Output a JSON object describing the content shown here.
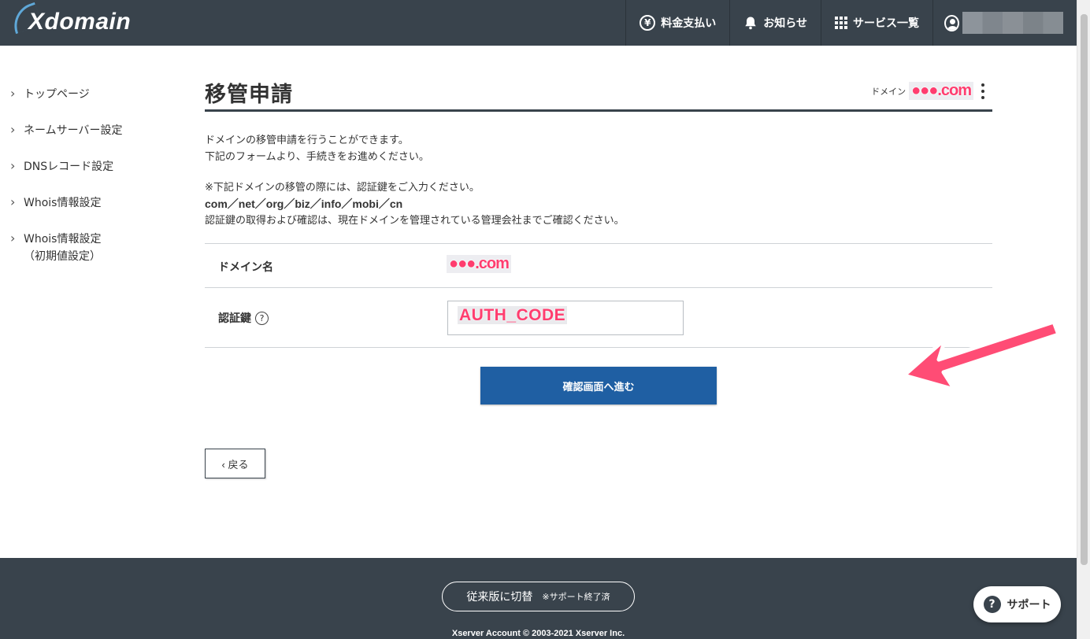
{
  "header": {
    "logo_text": "Xdomain",
    "nav": [
      {
        "label": "料金支払い",
        "icon": "yen-icon"
      },
      {
        "label": "お知らせ",
        "icon": "bell-icon"
      },
      {
        "label": "サービス一覧",
        "icon": "grid-icon"
      }
    ],
    "user_icon": "user-icon"
  },
  "sidebar": {
    "items": [
      {
        "label": "トップページ"
      },
      {
        "label": "ネームサーバー設定"
      },
      {
        "label": "DNSレコード設定"
      },
      {
        "label": "Whois情報設定"
      },
      {
        "label": "Whois情報設定",
        "sub": "（初期値設定）"
      }
    ]
  },
  "page": {
    "title": "移管申請",
    "domain_label": "ドメイン",
    "domain_value": "●●●.com",
    "intro_line1": "ドメインの移管申請を行うことができます。",
    "intro_line2": "下記のフォームより、手続きをお進めください。",
    "note_line1": "※下記ドメインの移管の際には、認証鍵をご入力ください。",
    "note_tlds": "com／net／org／biz／info／mobi／cn",
    "note_line3": "認証鍵の取得および確認は、現在ドメインを管理されている管理会社までご確認ください。"
  },
  "form": {
    "domain_name_label": "ドメイン名",
    "domain_name_value": "●●●.com",
    "auth_label": "認証鍵",
    "help_icon": "?",
    "auth_value": "AUTH_CODE"
  },
  "buttons": {
    "confirm": "確認画面へ進む",
    "back": "‹ 戻る"
  },
  "footer": {
    "legacy_label": "従来版に切替",
    "legacy_note": "※サポート終了済",
    "copyright": "Xserver Account © 2003-2021 Xserver Inc."
  },
  "support": {
    "icon": "?",
    "label": "サポート"
  },
  "colors": {
    "header_bg": "#39434c",
    "primary_button": "#1f5fa3",
    "annotation_arrow": "#ff4570"
  }
}
